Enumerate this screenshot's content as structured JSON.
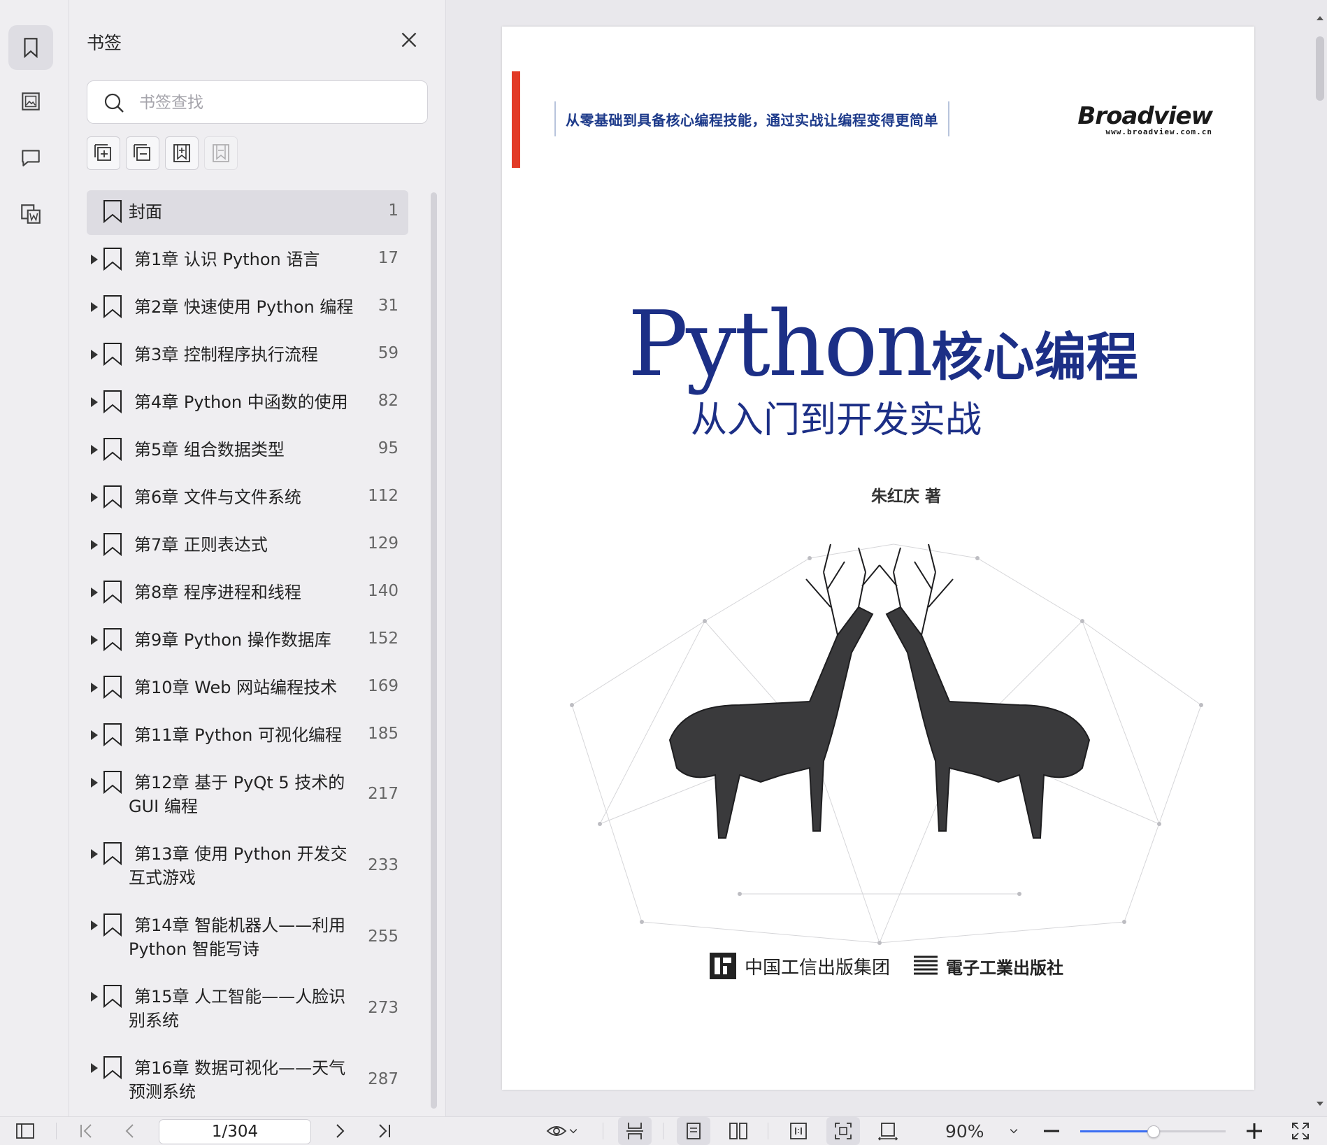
{
  "panel": {
    "title": "书签",
    "search_placeholder": "书签查找"
  },
  "bookmarks": [
    {
      "label": "封面",
      "page": "1"
    },
    {
      "label": "第1章 认识 Python 语言",
      "page": "17"
    },
    {
      "label": "第2章 快速使用 Python 编程",
      "page": "31"
    },
    {
      "label": "第3章 控制程序执行流程",
      "page": "59"
    },
    {
      "label": "第4章 Python 中函数的使用",
      "page": "82"
    },
    {
      "label": "第5章 组合数据类型",
      "page": "95"
    },
    {
      "label": "第6章 文件与文件系统",
      "page": "112"
    },
    {
      "label": "第7章 正则表达式",
      "page": "129"
    },
    {
      "label": "第8章 程序进程和线程",
      "page": "140"
    },
    {
      "label": "第9章 Python 操作数据库",
      "page": "152"
    },
    {
      "label": "第10章 Web 网站编程技术",
      "page": "169"
    },
    {
      "label": "第11章 Python 可视化编程",
      "page": "185"
    },
    {
      "label": "第12章 基于 PyQt 5 技术的 GUI 编程",
      "page": "217"
    },
    {
      "label": "第13章 使用 Python 开发交互式游戏",
      "page": "233"
    },
    {
      "label": "第14章 智能机器人——利用 Python 智能写诗",
      "page": "255"
    },
    {
      "label": "第15章 人工智能——人脸识别系统",
      "page": "273"
    },
    {
      "label": "第16章 数据可视化——天气预测系统",
      "page": "287"
    }
  ],
  "cover": {
    "tagline": "从零基础到具备核心编程技能，通过实战让编程变得更简单",
    "brand": "Broadview",
    "brand_url": "www.broadview.com.cn",
    "title_latin": "Python",
    "title_cn": "核心编程",
    "subtitle": "从入门到开发实战",
    "author": "朱红庆 著",
    "publisher1": "中国工信出版集团",
    "publisher2": "電子工業出版社"
  },
  "toolbar": {
    "page_indicator": "1/304",
    "zoom": "90%",
    "zoom_fraction": 0.5
  },
  "colors": {
    "accent": "#3b6ef2",
    "cover_blue": "#1c2f86",
    "cover_red": "#e23a26"
  }
}
